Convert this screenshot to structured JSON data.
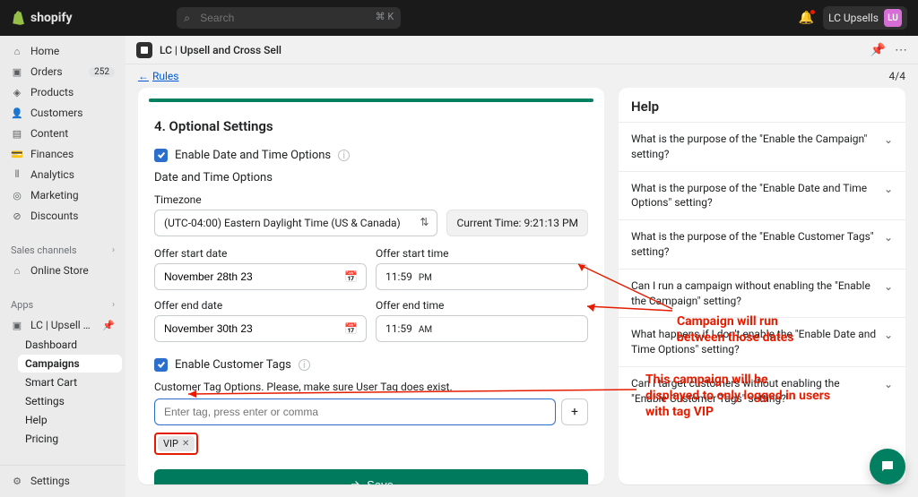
{
  "topbar": {
    "logo": "shopify",
    "search_placeholder": "Search",
    "kbd": "⌘ K",
    "account": "LC Upsells",
    "avatar": "LU"
  },
  "sidebar": {
    "primary": [
      {
        "icon": "⌂",
        "label": "Home"
      },
      {
        "icon": "▣",
        "label": "Orders",
        "badge": "252"
      },
      {
        "icon": "◈",
        "label": "Products"
      },
      {
        "icon": "👤",
        "label": "Customers"
      },
      {
        "icon": "▤",
        "label": "Content"
      },
      {
        "icon": "💳",
        "label": "Finances"
      },
      {
        "icon": "⫴",
        "label": "Analytics"
      },
      {
        "icon": "◎",
        "label": "Marketing"
      },
      {
        "icon": "⊘",
        "label": "Discounts"
      }
    ],
    "channels_header": "Sales channels",
    "channels": [
      {
        "icon": "⌂",
        "label": "Online Store"
      }
    ],
    "apps_header": "Apps",
    "apps": [
      {
        "icon": "▣",
        "label": "LC | Upsell and Cross ..."
      }
    ],
    "app_sub": [
      "Dashboard",
      "Campaigns",
      "Smart Cart",
      "Settings",
      "Help",
      "Pricing"
    ],
    "footer": "Settings"
  },
  "page": {
    "title": "LC | Upsell and Cross Sell",
    "breadcrumb": "Rules",
    "step": "4/4"
  },
  "form": {
    "heading": "4. Optional Settings",
    "enable_dt_label": "Enable Date and Time Options",
    "dt_section": "Date and Time Options",
    "tz_label": "Timezone",
    "tz_value": "(UTC-04:00) Eastern Daylight Time (US & Canada)",
    "current_time_label": "Current Time: 9:21:13 PM",
    "start_date_label": "Offer start date",
    "start_date": "November 28th 23",
    "start_time_label": "Offer start time",
    "start_time": "11:59",
    "start_ampm": "PM",
    "end_date_label": "Offer end date",
    "end_date": "November 30th 23",
    "end_time_label": "Offer end time",
    "end_time": "11:59",
    "end_ampm": "AM",
    "enable_tags_label": "Enable Customer Tags",
    "tags_hint": "Customer Tag Options. Please, make sure User Tag does exist.",
    "tags_placeholder": "Enter tag, press enter or comma",
    "tag_vip": "VIP",
    "save": "Save"
  },
  "help": {
    "title": "Help",
    "faqs": [
      "What is the purpose of the \"Enable the Campaign\" setting?",
      "What is the purpose of the \"Enable Date and Time Options\" setting?",
      "What is the purpose of the \"Enable Customer Tags\" setting?",
      "Can I run a campaign without enabling the \"Enable the Campaign\" setting?",
      "What happens if I don't enable the \"Enable Date and Time Options\" setting?",
      "Can I target customers without enabling the \"Enable Customer Tags\" setting?"
    ]
  },
  "annotations": {
    "a1": "Campaign will run\nbetween those dates",
    "a2": "This campaign will be\ndisplayed to only logged in users\nwith tag VIP"
  }
}
